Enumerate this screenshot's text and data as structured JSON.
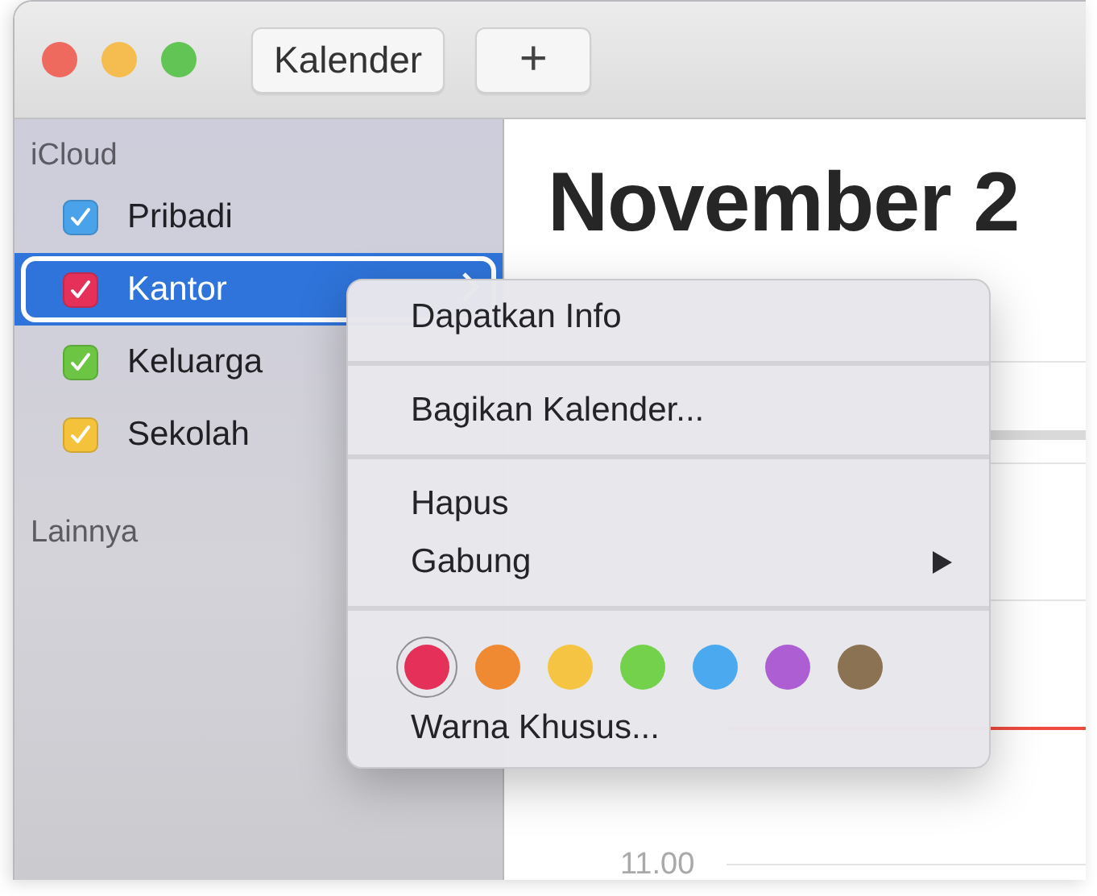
{
  "toolbar": {
    "buttons": [
      {
        "kind": "text",
        "label": "Kalender"
      },
      {
        "kind": "text",
        "label": "+"
      }
    ]
  },
  "sidebar": {
    "sections": [
      {
        "title": "iCloud",
        "calendars": [
          {
            "name": "Pribadi",
            "checked": true,
            "color": "#4aa3ea",
            "selected": false
          },
          {
            "name": "Kantor",
            "checked": true,
            "color": "#e5315a",
            "selected": true
          },
          {
            "name": "Keluarga",
            "checked": true,
            "color": "#6cc644",
            "selected": false
          },
          {
            "name": "Sekolah",
            "checked": true,
            "color": "#f5c33b",
            "selected": false
          }
        ]
      },
      {
        "title": "Lainnya"
      }
    ]
  },
  "main": {
    "title": "November 2",
    "time_labels": [
      "11.00"
    ]
  },
  "context_menu": {
    "items": [
      {
        "kind": "item",
        "label": "Dapatkan Info"
      },
      {
        "kind": "separator"
      },
      {
        "kind": "item",
        "label": "Bagikan Kalender..."
      },
      {
        "kind": "separator"
      },
      {
        "kind": "item",
        "label": "Hapus"
      },
      {
        "kind": "submenu",
        "label": "Gabung"
      },
      {
        "kind": "separator"
      },
      {
        "kind": "colors",
        "colors": [
          {
            "color": "#e5315a",
            "selected": true
          },
          {
            "color": "#ef8a33",
            "selected": false
          },
          {
            "color": "#f5c443",
            "selected": false
          },
          {
            "color": "#74d14c",
            "selected": false
          },
          {
            "color": "#4aa9ef",
            "selected": false
          },
          {
            "color": "#ad5ed2",
            "selected": false
          },
          {
            "color": "#8b7252",
            "selected": false
          }
        ]
      },
      {
        "kind": "item",
        "label": "Warna Khusus..."
      }
    ]
  }
}
